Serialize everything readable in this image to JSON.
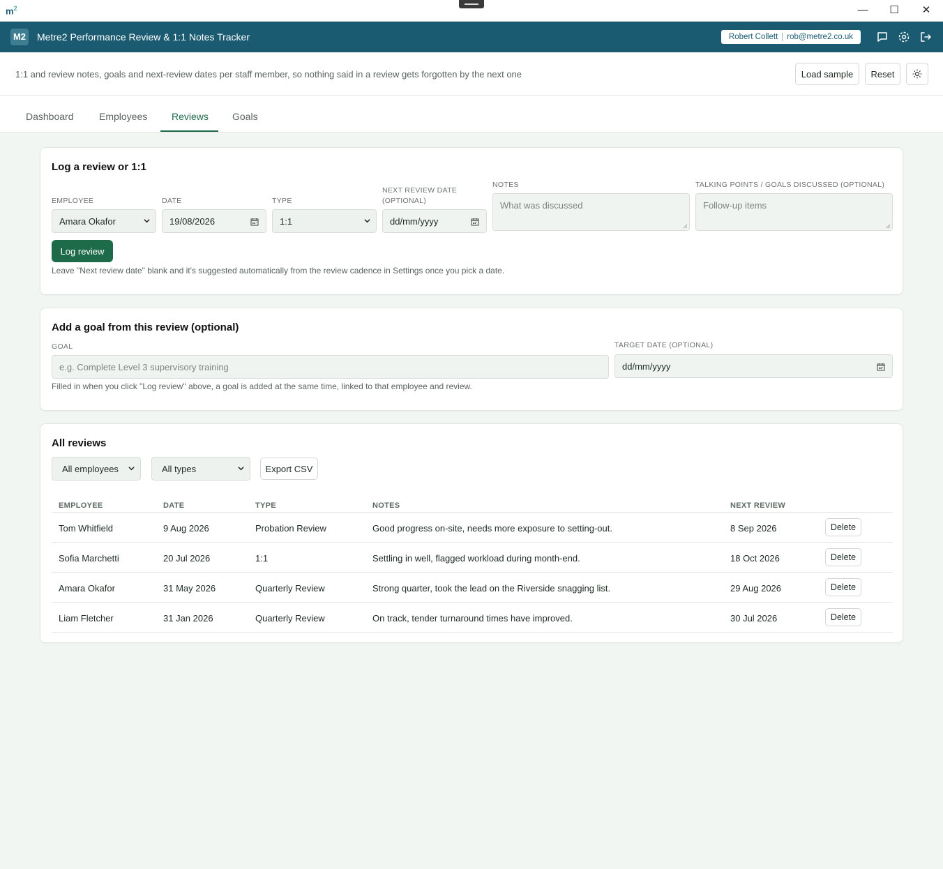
{
  "window": {
    "logo": "m",
    "logo_sup": "2",
    "minimize": "—",
    "maximize": "☐",
    "close": "✕"
  },
  "header": {
    "badge": "M2",
    "title": "Metre2 Performance Review & 1:1 Notes Tracker",
    "user_name": "Robert Collett",
    "user_email": "rob@metre2.co.uk"
  },
  "subbar": {
    "description": "1:1 and review notes, goals and next-review dates per staff member, so nothing said in a review gets forgotten by the next one",
    "load_sample": "Load sample",
    "reset": "Reset"
  },
  "tabs": [
    {
      "label": "Dashboard"
    },
    {
      "label": "Employees"
    },
    {
      "label": "Reviews"
    },
    {
      "label": "Goals"
    }
  ],
  "log_form": {
    "title": "Log a review or 1:1",
    "employee_label": "EMPLOYEE",
    "employee_value": "Amara Okafor",
    "date_label": "DATE",
    "date_value": "19/08/2026",
    "type_label": "TYPE",
    "type_value": "1:1",
    "next_label": "NEXT REVIEW DATE (OPTIONAL)",
    "next_placeholder": "dd/mm/yyyy",
    "notes_label": "NOTES",
    "notes_placeholder": "What was discussed",
    "talking_label": "TALKING POINTS / GOALS DISCUSSED (OPTIONAL)",
    "talking_placeholder": "Follow-up items",
    "submit": "Log review",
    "hint": "Leave \"Next review date\" blank and it's suggested automatically from the review cadence in Settings once you pick a date."
  },
  "goal_form": {
    "title": "Add a goal from this review (optional)",
    "goal_label": "GOAL",
    "goal_placeholder": "e.g. Complete Level 3 supervisory training",
    "target_label": "TARGET DATE (OPTIONAL)",
    "target_placeholder": "dd/mm/yyyy",
    "hint": "Filled in when you click \"Log review\" above, a goal is added at the same time, linked to that employee and review."
  },
  "reviews": {
    "title": "All reviews",
    "filter_employee": "All employees",
    "filter_type": "All types",
    "export": "Export CSV",
    "columns": [
      "EMPLOYEE",
      "DATE",
      "TYPE",
      "NOTES",
      "NEXT REVIEW"
    ],
    "delete_label": "Delete",
    "rows": [
      {
        "employee": "Tom Whitfield",
        "date": "9 Aug 2026",
        "type": "Probation Review",
        "notes": "Good progress on-site, needs more exposure to setting-out.",
        "next": "8 Sep 2026"
      },
      {
        "employee": "Sofia Marchetti",
        "date": "20 Jul 2026",
        "type": "1:1",
        "notes": "Settling in well, flagged workload during month-end.",
        "next": "18 Oct 2026"
      },
      {
        "employee": "Amara Okafor",
        "date": "31 May 2026",
        "type": "Quarterly Review",
        "notes": "Strong quarter, took the lead on the Riverside snagging list.",
        "next": "29 Aug 2026"
      },
      {
        "employee": "Liam Fletcher",
        "date": "31 Jan 2026",
        "type": "Quarterly Review",
        "notes": "On track, tender turnaround times have improved.",
        "next": "30 Jul 2026"
      }
    ]
  },
  "colors": {
    "header": "#1a5b72",
    "accent": "#1d6b48",
    "background": "#f2f6f3"
  },
  "icons": [
    "chat-icon",
    "gear-icon",
    "logout-icon",
    "sun-icon",
    "calendar-icon",
    "chevron-down-icon"
  ]
}
